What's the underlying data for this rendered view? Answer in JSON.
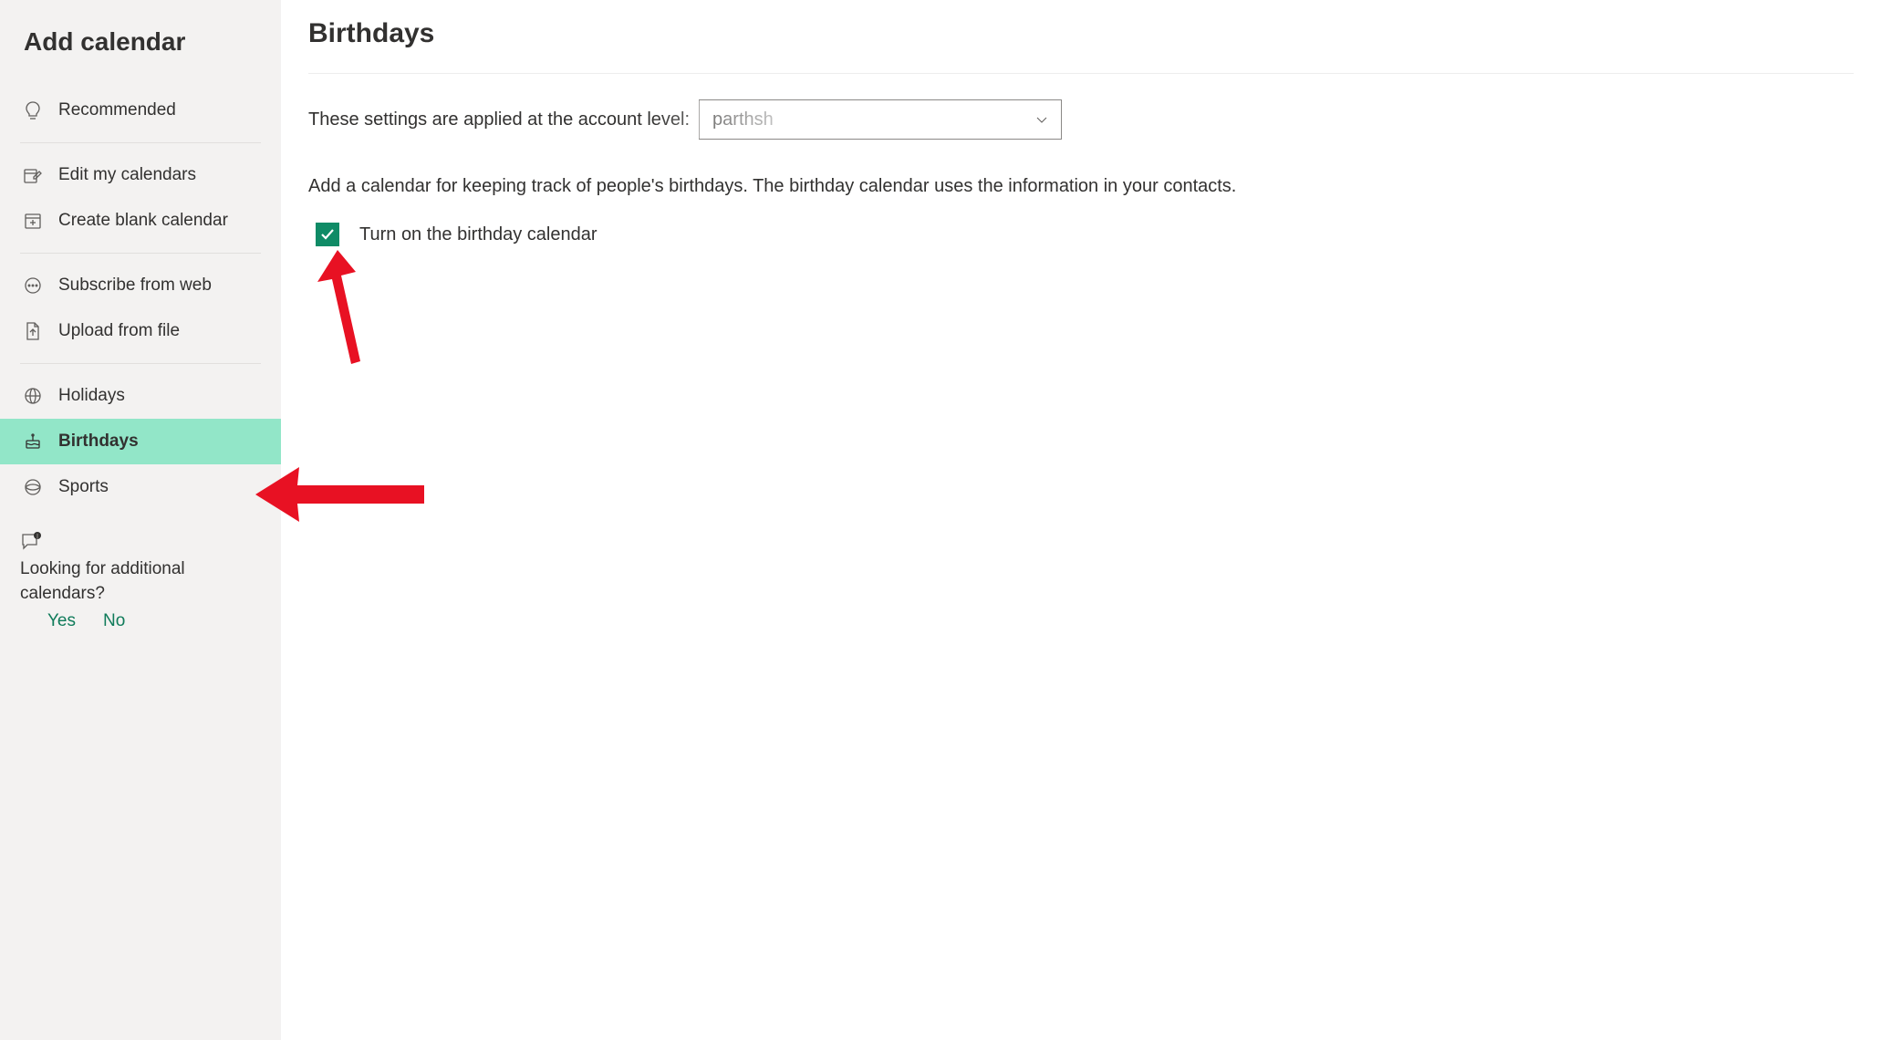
{
  "sidebar": {
    "title": "Add calendar",
    "groups": [
      {
        "items": [
          {
            "label": "Recommended",
            "icon": "lightbulb",
            "selected": false
          }
        ]
      },
      {
        "items": [
          {
            "label": "Edit my calendars",
            "icon": "edit-calendar",
            "selected": false
          },
          {
            "label": "Create blank calendar",
            "icon": "add-calendar",
            "selected": false
          }
        ]
      },
      {
        "items": [
          {
            "label": "Subscribe from web",
            "icon": "ellipsis-circle",
            "selected": false
          },
          {
            "label": "Upload from file",
            "icon": "file-upload",
            "selected": false
          }
        ]
      },
      {
        "items": [
          {
            "label": "Holidays",
            "icon": "globe",
            "selected": false
          },
          {
            "label": "Birthdays",
            "icon": "cake",
            "selected": true
          },
          {
            "label": "Sports",
            "icon": "sports",
            "selected": false
          }
        ]
      }
    ],
    "feedback": {
      "text": "Looking for additional calendars?",
      "yes": "Yes",
      "no": "No"
    }
  },
  "main": {
    "title": "Birthdays",
    "account_label": "These settings are applied at the account level:",
    "account_value": "parthsh",
    "description": "Add a calendar for keeping track of people's birthdays. The birthday calendar uses the information in your contacts.",
    "checkbox_label": "Turn on the birthday calendar",
    "checkbox_checked": true
  },
  "annotation": {
    "arrow_color": "#e81123"
  }
}
